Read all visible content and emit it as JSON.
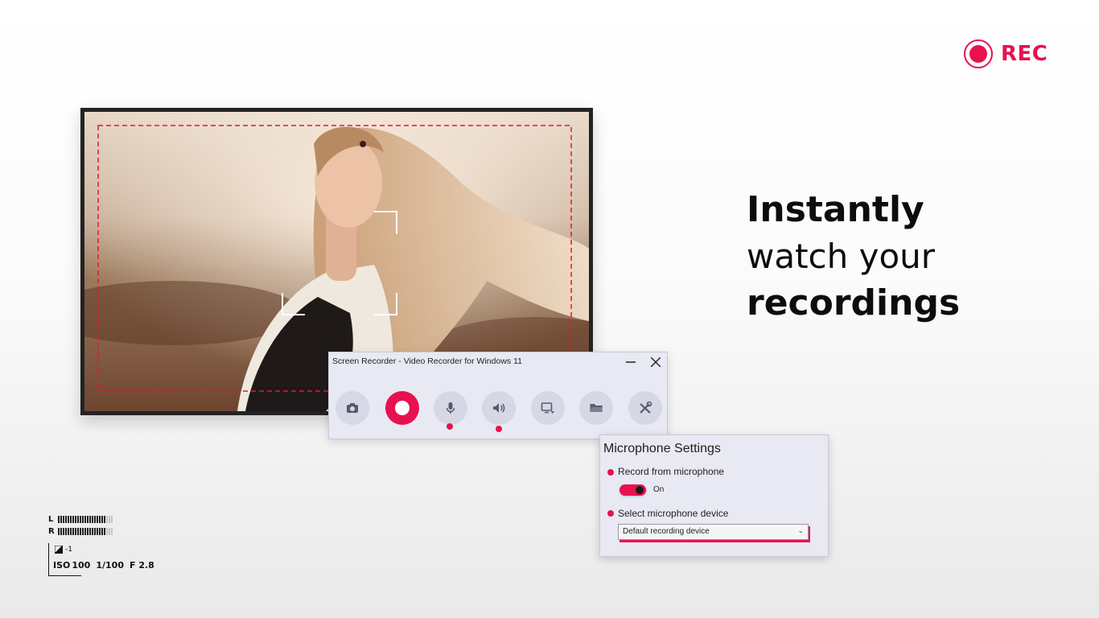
{
  "rec_badge": {
    "label": "REC",
    "color": "#e8114f"
  },
  "headline": {
    "line1": "Instantly",
    "line2": "watch your",
    "line3": "recordings"
  },
  "recorder_window": {
    "title": "Screen Recorder - Video Recorder for Windows 11",
    "minimize_glyph": "—",
    "close_glyph": "✕",
    "tools": [
      {
        "icon": "camera-icon",
        "active_indicator": false
      },
      {
        "icon": "record-icon",
        "active_indicator": false
      },
      {
        "icon": "microphone-icon",
        "active_indicator": true
      },
      {
        "icon": "speaker-icon",
        "active_indicator": true
      },
      {
        "icon": "monitor-dropdown-icon",
        "active_indicator": false
      },
      {
        "icon": "folder-icon",
        "active_indicator": false
      },
      {
        "icon": "tools-icon",
        "active_indicator": false
      }
    ]
  },
  "mic_settings": {
    "title": "Microphone Settings",
    "record_label": "Record from microphone",
    "toggle_state": "On",
    "toggle_on": true,
    "device_label": "Select microphone device",
    "device_value": "Default recording device"
  },
  "hud": {
    "left_channel": "L",
    "right_channel": "R",
    "exposure": "-1",
    "iso_label": "ISO",
    "iso_value": "100",
    "shutter": "1/100",
    "aperture": "F 2.8"
  },
  "colors": {
    "accent": "#e8114f",
    "panel": "#e8e9f3",
    "button": "#d6d8e6"
  }
}
